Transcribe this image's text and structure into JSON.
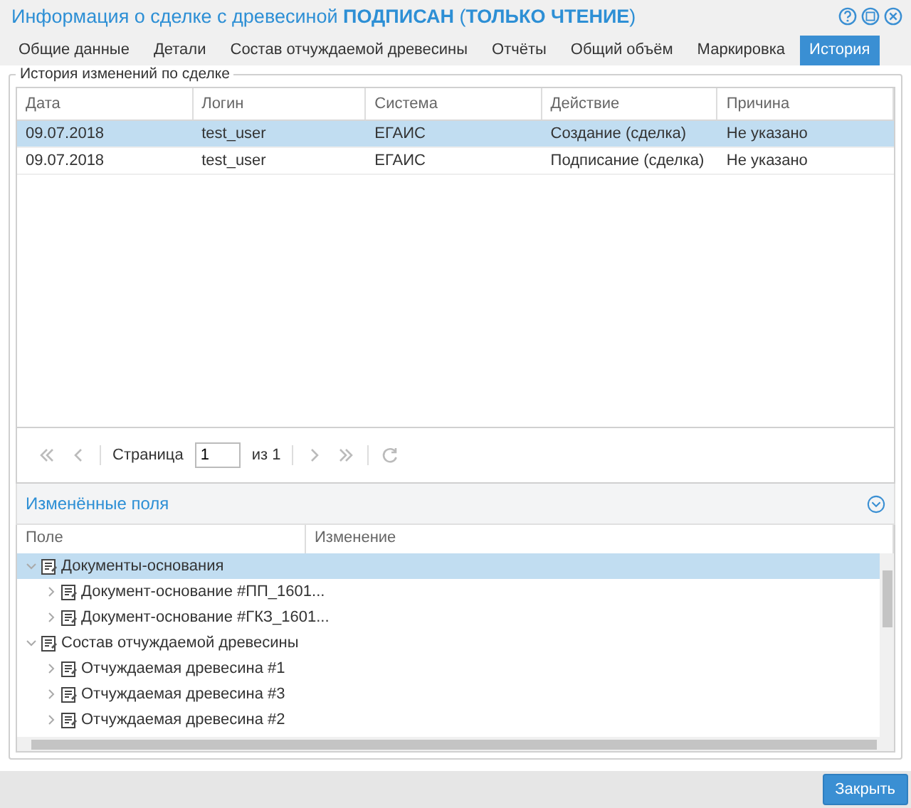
{
  "window": {
    "title": "Информация о сделке с древесиной **ПОДПИСАН** (**ТОЛЬКО ЧТЕНИЕ**)"
  },
  "tabs": [
    {
      "label": "Общие данные",
      "selected": false
    },
    {
      "label": "Детали",
      "selected": false
    },
    {
      "label": "Состав отчуждаемой древесины",
      "selected": false
    },
    {
      "label": "Отчёты",
      "selected": false
    },
    {
      "label": "Общий объём",
      "selected": false
    },
    {
      "label": "Маркировка",
      "selected": false
    },
    {
      "label": "История",
      "selected": true
    }
  ],
  "history": {
    "legend": "История изменений по сделке",
    "columns": [
      "Дата",
      "Логин",
      "Система",
      "Действие",
      "Причина"
    ],
    "rows": [
      {
        "selected": true,
        "cells": [
          "09.07.2018",
          "test_user",
          "ЕГАИС",
          "Создание (сделка)",
          "Не указано"
        ]
      },
      {
        "selected": false,
        "cells": [
          "09.07.2018",
          "test_user",
          "ЕГАИС",
          "Подписание (сделка)",
          "Не указано"
        ]
      }
    ],
    "pager": {
      "page_label": "Страница",
      "page": "1",
      "of": "из 1"
    }
  },
  "changed_fields": {
    "title": "Изменённые поля",
    "columns": [
      "Поле",
      "Изменение"
    ],
    "tree": [
      {
        "label": "Документы-основания",
        "expanded": true,
        "selected": true,
        "children": [
          {
            "label": "Документ-основание #ПП_1601...",
            "expanded": false,
            "selected": false
          },
          {
            "label": "Документ-основание #ГКЗ_1601...",
            "expanded": false,
            "selected": false
          }
        ]
      },
      {
        "label": "Состав отчуждаемой древесины",
        "expanded": true,
        "selected": false,
        "children": [
          {
            "label": "Отчуждаемая древесина #1",
            "expanded": false,
            "selected": false
          },
          {
            "label": "Отчуждаемая древесина #3",
            "expanded": false,
            "selected": false
          },
          {
            "label": "Отчуждаемая древесина #2",
            "expanded": false,
            "selected": false
          }
        ]
      }
    ]
  },
  "buttons": [
    "Закрыть"
  ]
}
